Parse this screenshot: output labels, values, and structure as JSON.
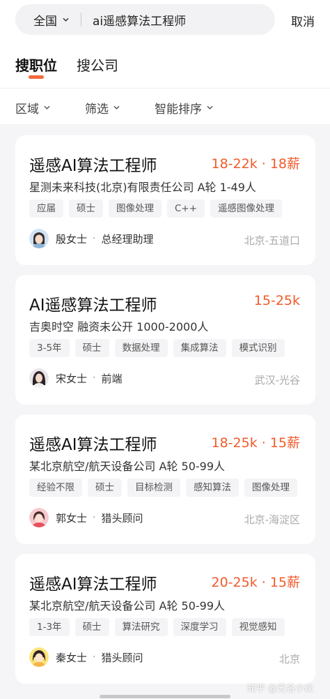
{
  "search": {
    "region": "全国",
    "query": "ai遥感算法工程师",
    "cancel": "取消"
  },
  "tabs": [
    {
      "label": "搜职位",
      "active": true
    },
    {
      "label": "搜公司",
      "active": false
    }
  ],
  "filters": [
    {
      "label": "区域"
    },
    {
      "label": "筛选"
    },
    {
      "label": "智能排序"
    }
  ],
  "colors": {
    "accent": "#f26b3a",
    "salary": "#f05b2b"
  },
  "jobs": [
    {
      "title": "遥感AI算法工程师",
      "salary": "18-22k · 18薪",
      "company": "星测未来科技(北京)有限责任公司  A轮  1-49人",
      "tags": [
        "应届",
        "硕士",
        "图像处理",
        "C++",
        "遥感图像处理"
      ],
      "recruiter_name": "殷女士",
      "recruiter_role": "总经理助理",
      "location": "北京-五道口"
    },
    {
      "title": "AI遥感算法工程师",
      "salary": "15-25k",
      "company": "吉奥时空  融资未公开  1000-2000人",
      "tags": [
        "3-5年",
        "硕士",
        "数据处理",
        "集成算法",
        "模式识别"
      ],
      "recruiter_name": "宋女士",
      "recruiter_role": "前端",
      "location": "武汉-光谷"
    },
    {
      "title": "遥感AI算法工程师",
      "salary": "18-25k · 15薪",
      "company": "某北京航空/航天设备公司  A轮  50-99人",
      "tags": [
        "经验不限",
        "硕士",
        "目标检测",
        "感知算法",
        "图像处理"
      ],
      "recruiter_name": "郭女士",
      "recruiter_role": "猎头顾问",
      "location": "北京-海淀区"
    },
    {
      "title": "遥感AI算法工程师",
      "salary": "20-25k · 15薪",
      "company": "某北京航空/航天设备公司  A轮  50-99人",
      "tags": [
        "1-3年",
        "硕士",
        "算法研究",
        "深度学习",
        "视觉感知"
      ],
      "recruiter_name": "秦女士",
      "recruiter_role": "猎头顾问",
      "location": "北京"
    }
  ],
  "watermark": "知乎 @无名小伙"
}
